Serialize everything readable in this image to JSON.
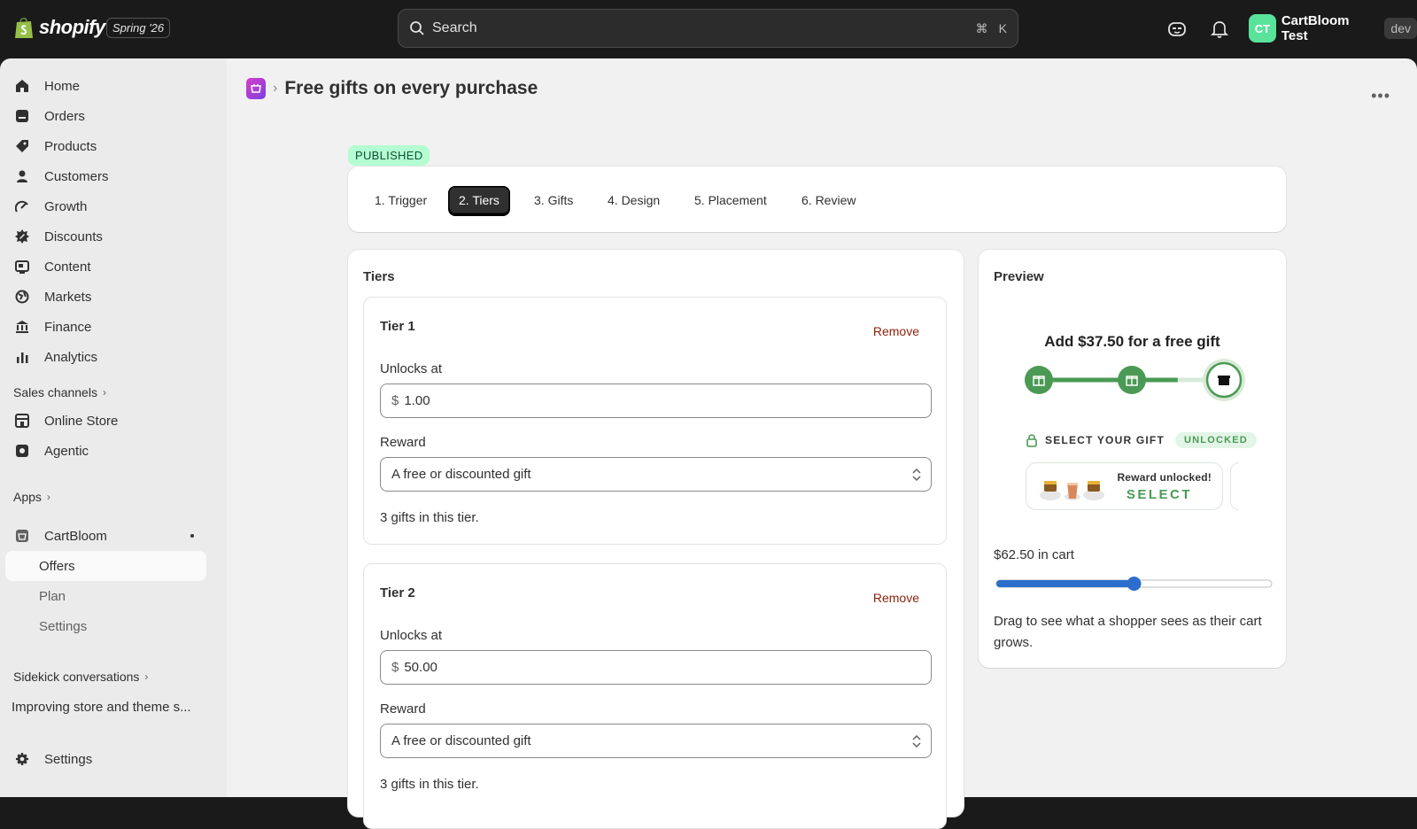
{
  "topbar": {
    "brand": "shopify",
    "edition": "Spring '26",
    "search_placeholder": "Search",
    "search_shortcut_cmd": "⌘",
    "search_shortcut_key": "K",
    "avatar_initials": "CT",
    "store_name": "CartBloom Test",
    "env_badge": "dev"
  },
  "sidebar": {
    "items": [
      {
        "label": "Home",
        "icon": "home-icon"
      },
      {
        "label": "Orders",
        "icon": "orders-icon"
      },
      {
        "label": "Products",
        "icon": "tag-icon"
      },
      {
        "label": "Customers",
        "icon": "person-icon"
      },
      {
        "label": "Growth",
        "icon": "growth-icon"
      },
      {
        "label": "Discounts",
        "icon": "discount-icon"
      },
      {
        "label": "Content",
        "icon": "content-icon"
      },
      {
        "label": "Markets",
        "icon": "globe-icon"
      },
      {
        "label": "Finance",
        "icon": "bank-icon"
      },
      {
        "label": "Analytics",
        "icon": "chart-icon"
      }
    ],
    "sales_channels_label": "Sales channels",
    "channels": [
      {
        "label": "Online Store",
        "icon": "store-icon"
      },
      {
        "label": "Agentic",
        "icon": "agentic-icon"
      }
    ],
    "apps_label": "Apps",
    "app_name": "CartBloom",
    "app_subitems": [
      "Offers",
      "Plan",
      "Settings"
    ],
    "sidekick_label": "Sidekick conversations",
    "sidekick_item": "Improving store and theme s...",
    "settings_label": "Settings"
  },
  "page": {
    "title": "Free gifts on every purchase",
    "status_badge": "PUBLISHED",
    "tabs": [
      "1. Trigger",
      "2. Tiers",
      "3. Gifts",
      "4. Design",
      "5. Placement",
      "6. Review"
    ],
    "active_tab": 1
  },
  "tiers_card": {
    "title": "Tiers",
    "tiers": [
      {
        "name": "Tier 1",
        "remove_label": "Remove",
        "unlocks_label": "Unlocks at",
        "currency": "$",
        "amount": "1.00",
        "reward_label": "Reward",
        "reward_value": "A free or discounted gift",
        "note": "3 gifts in this tier."
      },
      {
        "name": "Tier 2",
        "remove_label": "Remove",
        "unlocks_label": "Unlocks at",
        "currency": "$",
        "amount": "50.00",
        "reward_label": "Reward",
        "reward_value": "A free or discounted gift",
        "note": "3 gifts in this tier."
      }
    ]
  },
  "preview": {
    "title": "Preview",
    "headline": "Add $37.50 for a free gift",
    "progress_fraction": 0.75,
    "select_label": "SELECT YOUR GIFT",
    "unlocked_badge": "UNLOCKED",
    "reward_unlocked": "Reward unlocked!",
    "select_button": "SELECT",
    "cart_value": "$62.50 in cart",
    "slider_fraction": 0.5,
    "help_text": "Drag to see what a shopper sees as their cart grows."
  },
  "colors": {
    "accent_green": "#4a9a55",
    "avatar_green": "#58e29a",
    "remove_red": "#8e1f0b",
    "slider_blue": "#2c6ecb"
  }
}
